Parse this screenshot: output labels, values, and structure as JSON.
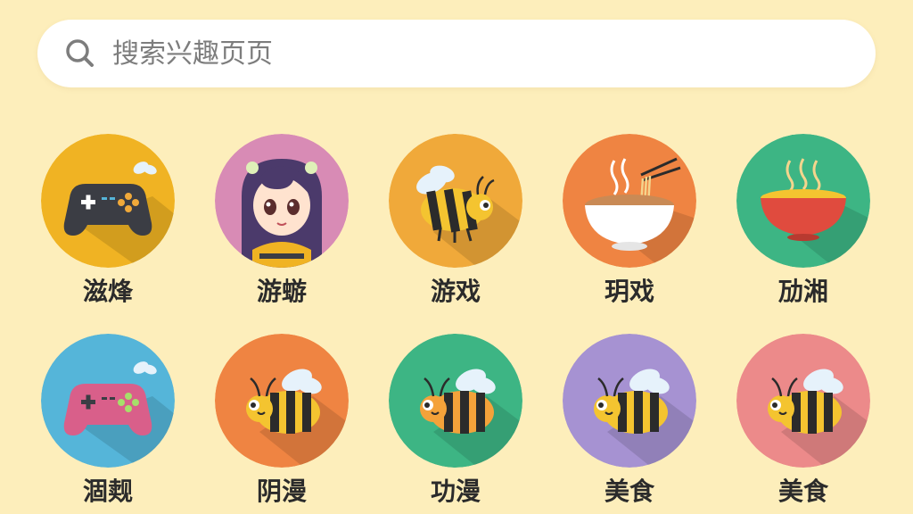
{
  "search": {
    "placeholder": "搜索兴趣页页",
    "icon": "search-icon"
  },
  "colors": {
    "background": "#fdeebb",
    "search_bg": "#ffffff",
    "placeholder_text": "#7d7d7d",
    "label_text": "#2b2b2b"
  },
  "categories": [
    {
      "label": "滋烽",
      "icon": "gamepad-icon",
      "color": "#f0b323"
    },
    {
      "label": "游蝣",
      "icon": "anime-girl-icon",
      "color": "#d88bb5"
    },
    {
      "label": "游戏",
      "icon": "bee-icon",
      "color": "#f0a93a"
    },
    {
      "label": "玥戏",
      "icon": "noodle-bowl-icon",
      "color": "#ef8442"
    },
    {
      "label": "劢湘",
      "icon": "soup-bowl-icon",
      "color": "#3db584"
    },
    {
      "label": "涸觌",
      "icon": "gamepad-icon",
      "color": "#55b5d9"
    },
    {
      "label": "阴漫",
      "icon": "bee-icon",
      "color": "#ef8442"
    },
    {
      "label": "功漫",
      "icon": "bee-icon",
      "color": "#3db584"
    },
    {
      "label": "美食",
      "icon": "bee-icon",
      "color": "#a692d2"
    },
    {
      "label": "美食",
      "icon": "bee-icon",
      "color": "#ec8a8a"
    }
  ]
}
